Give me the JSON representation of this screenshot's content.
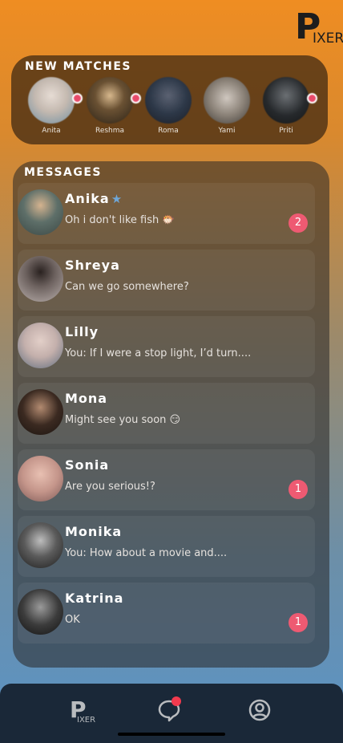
{
  "app": {
    "logo_big": "P",
    "logo_small": "IXER"
  },
  "new_matches": {
    "title": "NEW MATCHES",
    "items": [
      {
        "name": "Anita",
        "online": true,
        "color": "#c4b9b0"
      },
      {
        "name": "Reshma",
        "online": true,
        "color": "#4b3a26"
      },
      {
        "name": "Roma",
        "online": false,
        "color": "#2d3848"
      },
      {
        "name": "Yami",
        "online": false,
        "color": "#8b8278"
      },
      {
        "name": "Priti",
        "online": true,
        "color": "#26292c"
      }
    ]
  },
  "messages": {
    "title": "MESSAGES",
    "items": [
      {
        "name": "Anika",
        "preview": "Oh i don't like fish 🐡",
        "badge": "2",
        "verified": true,
        "color": "#5e6f69"
      },
      {
        "name": "Shreya",
        "preview": "Can we go somewhere?",
        "badge": "",
        "verified": false,
        "color": "#b8aeab"
      },
      {
        "name": "Lilly",
        "preview": "You: If I were a stop light, I’d turn....",
        "badge": "",
        "verified": false,
        "color": "#c4b0ac"
      },
      {
        "name": "Mona",
        "preview": "Might see you soon 😏",
        "badge": "",
        "verified": false,
        "color": "#3b2a21"
      },
      {
        "name": "Sonia",
        "preview": "Are you serious!?",
        "badge": "1",
        "verified": false,
        "color": "#c4958a"
      },
      {
        "name": "Monika",
        "preview": "You: How about a movie and....",
        "badge": "",
        "verified": false,
        "color": "#5b5b5b"
      },
      {
        "name": "Katrina",
        "preview": "OK",
        "badge": "1",
        "verified": false,
        "color": "#3c3c3c"
      }
    ]
  },
  "tabbar": {
    "home_big": "P",
    "home_small": "IXER",
    "chat_has_notification": true,
    "colors": {
      "notification": "#f23a4e",
      "icon": "#b9bcbf"
    }
  }
}
